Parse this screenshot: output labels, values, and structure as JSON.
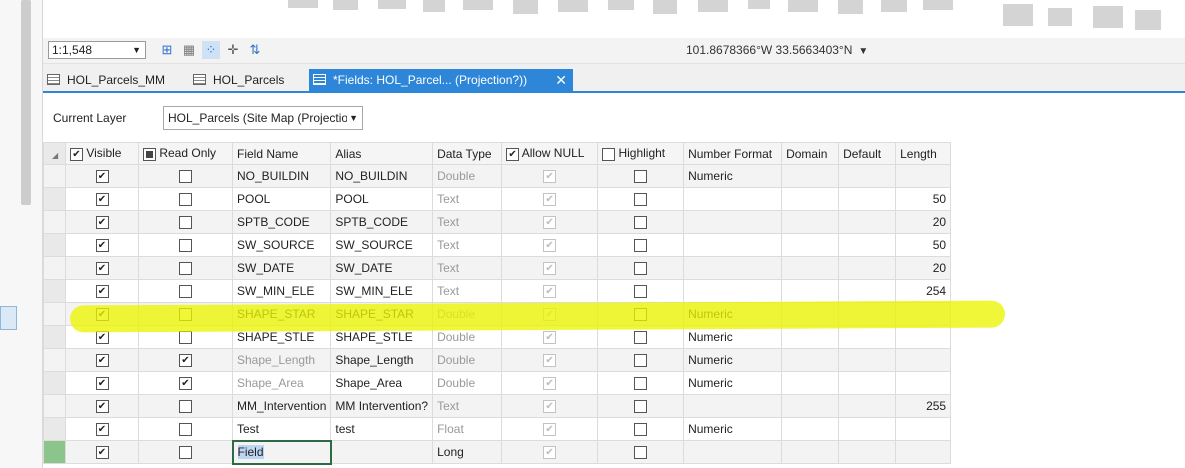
{
  "map": {
    "scale": "1:1,548",
    "coordinates": "101.8678366°W 33.5663403°N",
    "tools": [
      "add-field-icon",
      "table-icon",
      "select-icon",
      "pan-icon",
      "sort-icon"
    ]
  },
  "tabs": [
    {
      "label": "HOL_Parcels_MM"
    },
    {
      "label": "HOL_Parcels"
    },
    {
      "label": "*Fields:  HOL_Parcel... (Projection?))",
      "close": "✕"
    }
  ],
  "layer": {
    "label": "Current Layer",
    "value": "HOL_Parcels (Site Map (Projection"
  },
  "columns": {
    "visible": "Visible",
    "read_only": "Read Only",
    "field_name": "Field Name",
    "alias": "Alias",
    "data_type": "Data Type",
    "allow_null": "Allow NULL",
    "highlight": "Highlight",
    "number_format": "Number Format",
    "domain": "Domain",
    "default": "Default",
    "length": "Length"
  },
  "rows": [
    {
      "visible": true,
      "read_only": false,
      "field_name": "NO_BUILDIN",
      "alias": "NO_BUILDIN",
      "data_type": "Double",
      "allow_null": true,
      "highlight": false,
      "number_format": "Numeric",
      "domain": "",
      "default": "",
      "length": ""
    },
    {
      "visible": true,
      "read_only": false,
      "field_name": "POOL",
      "alias": "POOL",
      "data_type": "Text",
      "allow_null": true,
      "highlight": false,
      "number_format": "",
      "domain": "",
      "default": "",
      "length": "50"
    },
    {
      "visible": true,
      "read_only": false,
      "field_name": "SPTB_CODE",
      "alias": "SPTB_CODE",
      "data_type": "Text",
      "allow_null": true,
      "highlight": false,
      "number_format": "",
      "domain": "",
      "default": "",
      "length": "20"
    },
    {
      "visible": true,
      "read_only": false,
      "field_name": "SW_SOURCE",
      "alias": "SW_SOURCE",
      "data_type": "Text",
      "allow_null": true,
      "highlight": false,
      "number_format": "",
      "domain": "",
      "default": "",
      "length": "50"
    },
    {
      "visible": true,
      "read_only": false,
      "field_name": "SW_DATE",
      "alias": "SW_DATE",
      "data_type": "Text",
      "allow_null": true,
      "highlight": false,
      "number_format": "",
      "domain": "",
      "default": "",
      "length": "20"
    },
    {
      "visible": true,
      "read_only": false,
      "field_name": "SW_MIN_ELE",
      "alias": "SW_MIN_ELE",
      "data_type": "Text",
      "allow_null": true,
      "highlight": false,
      "number_format": "",
      "domain": "",
      "default": "",
      "length": "254"
    },
    {
      "visible": true,
      "read_only": false,
      "field_name": "SHAPE_STAR",
      "alias": "SHAPE_STAR",
      "data_type": "Double",
      "allow_null": true,
      "highlight": false,
      "number_format": "Numeric",
      "domain": "",
      "default": "",
      "length": ""
    },
    {
      "visible": true,
      "read_only": false,
      "field_name": "SHAPE_STLE",
      "alias": "SHAPE_STLE",
      "data_type": "Double",
      "allow_null": true,
      "highlight": false,
      "number_format": "Numeric",
      "domain": "",
      "default": "",
      "length": ""
    },
    {
      "visible": true,
      "read_only": true,
      "field_name": "Shape_Length",
      "alias": "Shape_Length",
      "data_type": "Double",
      "allow_null": true,
      "highlight": false,
      "number_format": "Numeric",
      "domain": "",
      "default": "",
      "length": ""
    },
    {
      "visible": true,
      "read_only": true,
      "field_name": "Shape_Area",
      "alias": "Shape_Area",
      "data_type": "Double",
      "allow_null": true,
      "highlight": false,
      "number_format": "Numeric",
      "domain": "",
      "default": "",
      "length": ""
    },
    {
      "visible": true,
      "read_only": false,
      "field_name": "MM_Intervention",
      "alias": "MM Intervention?",
      "data_type": "Text",
      "allow_null": true,
      "highlight": false,
      "number_format": "",
      "domain": "",
      "default": "",
      "length": "255"
    },
    {
      "visible": true,
      "read_only": false,
      "field_name": "Test",
      "alias": "test",
      "data_type": "Float",
      "allow_null": true,
      "highlight": false,
      "number_format": "Numeric",
      "domain": "",
      "default": "",
      "length": ""
    },
    {
      "visible": true,
      "read_only": false,
      "field_name": "Field",
      "alias": "",
      "data_type": "Long",
      "allow_null": true,
      "highlight": false,
      "number_format": "",
      "domain": "",
      "default": "",
      "length": ""
    }
  ]
}
